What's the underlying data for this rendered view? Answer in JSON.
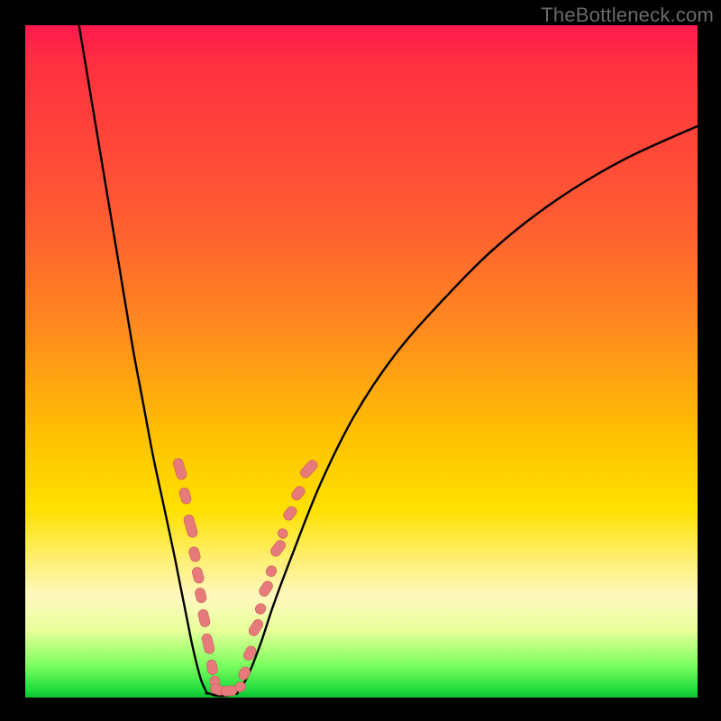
{
  "watermark": "TheBottleneck.com",
  "colors": {
    "frame": "#000000",
    "curve": "#000000",
    "marker_fill": "#e77b7b",
    "marker_stroke": "#c85959"
  },
  "chart_data": {
    "type": "line",
    "title": "",
    "xlabel": "",
    "ylabel": "",
    "xlim": [
      0,
      100
    ],
    "ylim": [
      0,
      100
    ],
    "series": [
      {
        "name": "left-branch",
        "x": [
          8,
          10,
          12,
          14,
          16,
          17.5,
          19,
          20.5,
          22,
          23,
          24,
          24.8,
          25.5,
          26.2,
          27
        ],
        "y": [
          100,
          88,
          76,
          64,
          52,
          44,
          36,
          29,
          22,
          17,
          12,
          8,
          5,
          2.5,
          0.7
        ]
      },
      {
        "name": "valley-floor",
        "x": [
          27,
          28.5,
          30,
          31.5
        ],
        "y": [
          0.7,
          0.3,
          0.3,
          0.7
        ]
      },
      {
        "name": "right-branch",
        "x": [
          31.5,
          33,
          35,
          37,
          40,
          44,
          49,
          55,
          62,
          70,
          79,
          89,
          100
        ],
        "y": [
          0.7,
          3,
          8,
          14,
          22,
          32,
          42,
          51,
          59,
          67,
          74,
          80,
          85
        ]
      }
    ],
    "markers": [
      {
        "x": 23.0,
        "y": 34.0,
        "len": 3.2,
        "angle": 74
      },
      {
        "x": 23.8,
        "y": 30.0,
        "len": 2.4,
        "angle": 74
      },
      {
        "x": 24.6,
        "y": 25.5,
        "len": 3.4,
        "angle": 74
      },
      {
        "x": 25.2,
        "y": 21.3,
        "len": 2.2,
        "angle": 74
      },
      {
        "x": 25.7,
        "y": 18.2,
        "len": 2.4,
        "angle": 74
      },
      {
        "x": 26.1,
        "y": 15.2,
        "len": 2.2,
        "angle": 75
      },
      {
        "x": 26.6,
        "y": 11.8,
        "len": 2.6,
        "angle": 76
      },
      {
        "x": 27.2,
        "y": 8.0,
        "len": 3.0,
        "angle": 77
      },
      {
        "x": 27.8,
        "y": 4.5,
        "len": 2.2,
        "angle": 78
      },
      {
        "x": 28.2,
        "y": 2.4,
        "len": 1.6,
        "angle": 80
      },
      {
        "x": 28.6,
        "y": 1.2,
        "len": 2.2,
        "angle": 20
      },
      {
        "x": 30.3,
        "y": 1.0,
        "len": 2.4,
        "angle": -5
      },
      {
        "x": 32.0,
        "y": 1.6,
        "len": 1.6,
        "angle": -25
      },
      {
        "x": 32.6,
        "y": 3.6,
        "len": 2.0,
        "angle": -62
      },
      {
        "x": 33.4,
        "y": 6.6,
        "len": 2.2,
        "angle": -60
      },
      {
        "x": 34.3,
        "y": 10.4,
        "len": 2.6,
        "angle": -58
      },
      {
        "x": 35.0,
        "y": 13.2,
        "len": 1.6,
        "angle": -57
      },
      {
        "x": 35.8,
        "y": 16.2,
        "len": 2.4,
        "angle": -56
      },
      {
        "x": 36.6,
        "y": 18.8,
        "len": 1.6,
        "angle": -55
      },
      {
        "x": 37.6,
        "y": 22.2,
        "len": 2.6,
        "angle": -53
      },
      {
        "x": 38.3,
        "y": 24.4,
        "len": 1.4,
        "angle": -52
      },
      {
        "x": 39.4,
        "y": 27.4,
        "len": 2.2,
        "angle": -51
      },
      {
        "x": 40.6,
        "y": 30.4,
        "len": 2.2,
        "angle": -50
      },
      {
        "x": 42.2,
        "y": 34.0,
        "len": 3.0,
        "angle": -48
      }
    ]
  }
}
